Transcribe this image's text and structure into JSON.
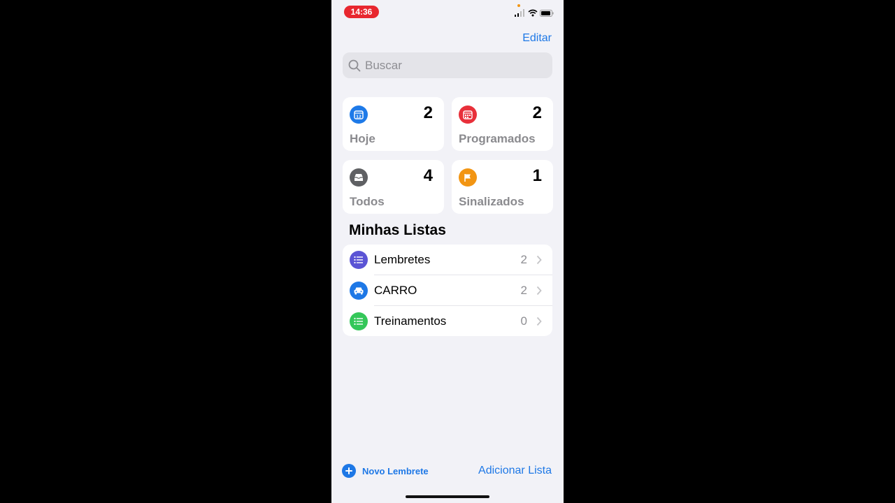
{
  "colors": {
    "accent": "#1e78e6",
    "today": "#1e7ae8",
    "scheduled": "#e8303a",
    "all": "#5f6063",
    "flagged": "#f29513",
    "list_purple": "#5b54d5",
    "list_blue": "#1e78e6",
    "list_green": "#34c759",
    "time_pill": "#e8272f",
    "privacy_dot": "#f29513"
  },
  "status": {
    "time": "14:36"
  },
  "header": {
    "edit": "Editar"
  },
  "search": {
    "placeholder": "Buscar"
  },
  "smart_lists": [
    {
      "label": "Hoje",
      "count": "2",
      "icon": "calendar-today-icon"
    },
    {
      "label": "Programados",
      "count": "2",
      "icon": "calendar-icon"
    },
    {
      "label": "Todos",
      "count": "4",
      "icon": "tray-icon"
    },
    {
      "label": "Sinalizados",
      "count": "1",
      "icon": "flag-icon"
    }
  ],
  "calendar_day": "12",
  "my_lists_title": "Minhas Listas",
  "lists": [
    {
      "name": "Lembretes",
      "count": "2",
      "icon": "list-bullet-icon"
    },
    {
      "name": "CARRO",
      "count": "2",
      "icon": "car-icon"
    },
    {
      "name": "Treinamentos",
      "count": "0",
      "icon": "list-bullet-icon"
    }
  ],
  "footer": {
    "new_reminder": "Novo Lembrete",
    "add_list": "Adicionar Lista"
  }
}
